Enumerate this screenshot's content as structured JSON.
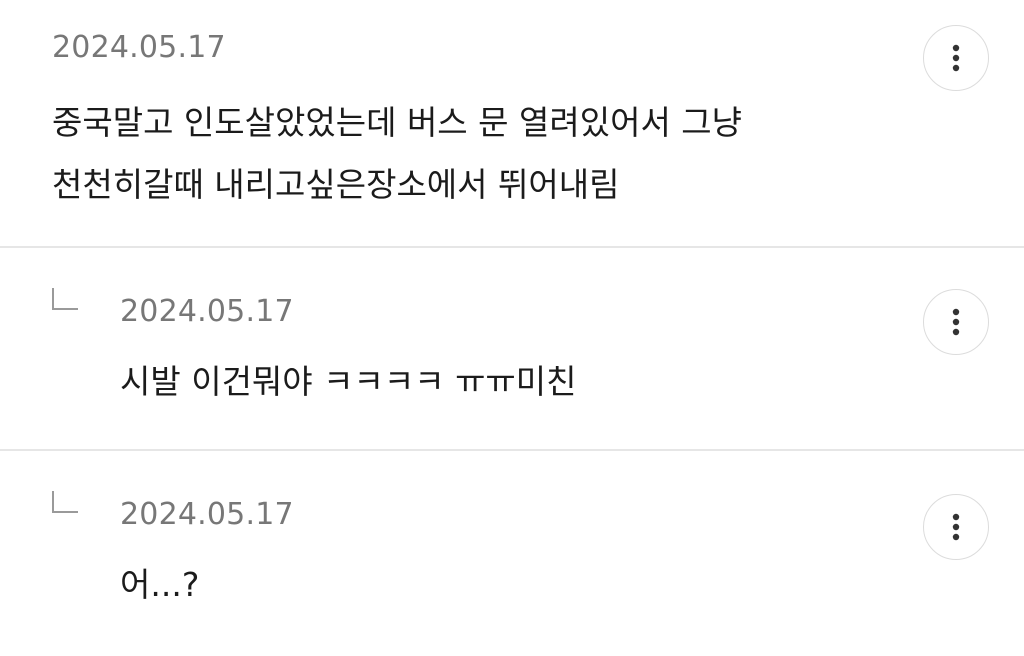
{
  "comments": [
    {
      "date": "2024.05.17",
      "lines": [
        "중국말고 인도살았었는데 버스 문 열려있어서 그냥",
        "천천히갈때 내리고싶은장소에서 뛰어내림"
      ],
      "more_icon": "more-vertical-icon"
    }
  ],
  "replies": [
    {
      "date": "2024.05.17",
      "text": "시발 이건뭐야 ㅋㅋㅋㅋ ㅠㅠ미친",
      "more_icon": "more-vertical-icon"
    },
    {
      "date": "2024.05.17",
      "text": "어...?",
      "more_icon": "more-vertical-icon"
    }
  ]
}
